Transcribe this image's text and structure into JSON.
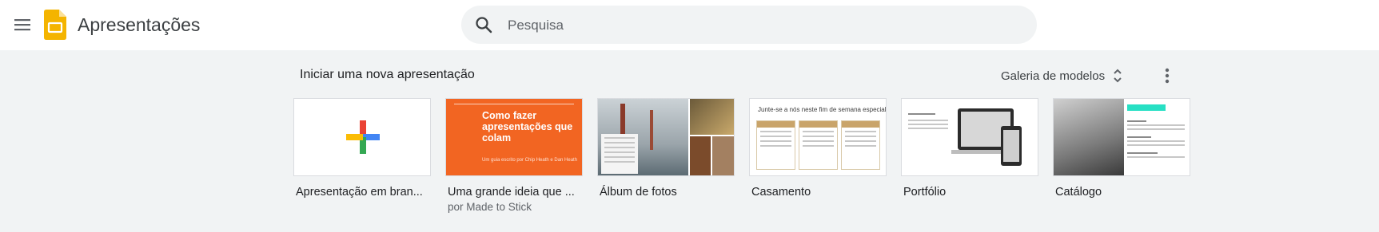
{
  "header": {
    "app_title": "Apresentações",
    "search_placeholder": "Pesquisa"
  },
  "section": {
    "title": "Iniciar uma nova apresentação",
    "gallery_label": "Galeria de modelos"
  },
  "templates": [
    {
      "name": "Apresentação em bran...",
      "author": ""
    },
    {
      "name": "Uma grande ideia que ...",
      "author": "por Made to Stick"
    },
    {
      "name": "Álbum de fotos",
      "author": ""
    },
    {
      "name": "Casamento",
      "author": ""
    },
    {
      "name": "Portfólio",
      "author": ""
    },
    {
      "name": "Catálogo",
      "author": ""
    }
  ],
  "thumbnails": {
    "pitch_title": "Como fazer apresentações que colam",
    "pitch_subtitle": "Um guia escrito por Chip Heath e Dan Heath",
    "wedding_heading": "Junte-se a nós neste fim de semana especial!"
  },
  "colors": {
    "brand_yellow": "#f4b400",
    "accent_orange": "#f26522",
    "background": "#f1f3f4"
  },
  "icons": {
    "menu": "hamburger-menu-icon",
    "logo": "slides-logo-icon",
    "search": "search-icon",
    "sort": "unfold-icon",
    "more": "more-vert-icon"
  }
}
